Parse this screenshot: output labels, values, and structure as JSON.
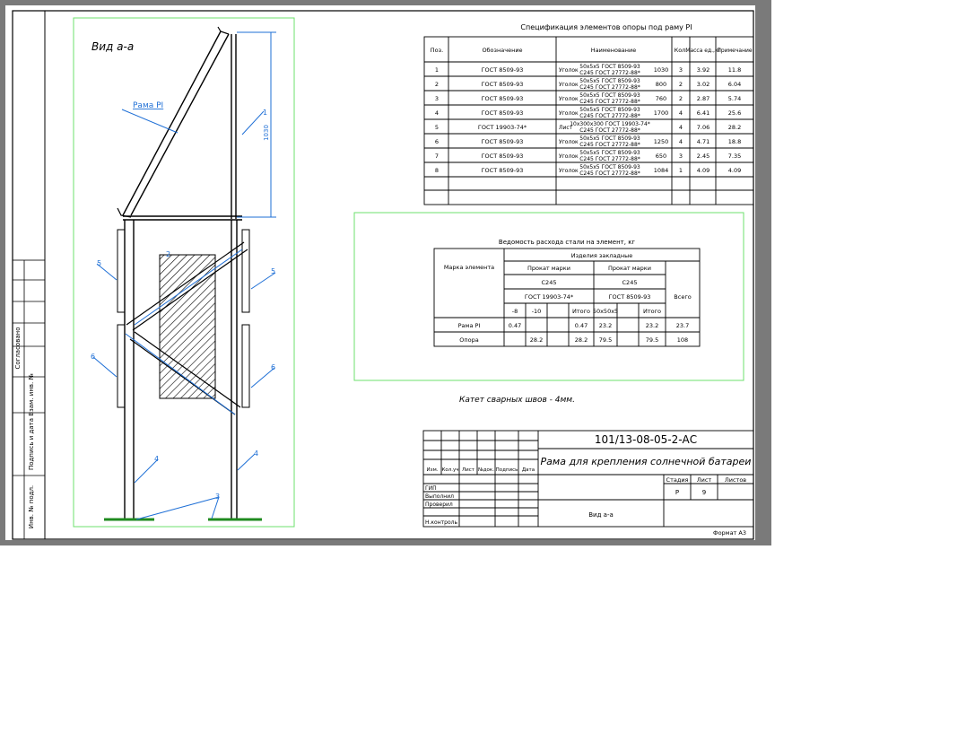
{
  "view_title": "Вид а-а",
  "frame_label": "Рама PI",
  "dimension_1": "1030",
  "markers": [
    "1",
    "2",
    "3",
    "4",
    "5",
    "6"
  ],
  "stamp_side": [
    "Согласовано",
    "Взам. инв. №",
    "Подпись и дата",
    "Инв. № подл."
  ],
  "spec": {
    "title": "Спецификация элементов опоры под раму PI",
    "headers": [
      "Поз.",
      "Обозначение",
      "Наименование",
      "Кол.",
      "Масса ед.,кг",
      "Примечание"
    ],
    "rows": [
      {
        "pos": "1",
        "designation": "ГОСТ 8509-93",
        "name_prefix": "Уголок",
        "name_top": "50х5х5 ГОСТ 8509-93",
        "name_bottom": "С245 ГОСТ 27772-88*",
        "length": "1030",
        "qty": "3",
        "mass": "3.92",
        "note": "11.8"
      },
      {
        "pos": "2",
        "designation": "ГОСТ 8509-93",
        "name_prefix": "Уголок",
        "name_top": "50х5х5 ГОСТ 8509-93",
        "name_bottom": "С245 ГОСТ 27772-88*",
        "length": "800",
        "qty": "2",
        "mass": "3.02",
        "note": "6.04"
      },
      {
        "pos": "3",
        "designation": "ГОСТ 8509-93",
        "name_prefix": "Уголок",
        "name_top": "50х5х5 ГОСТ 8509-93",
        "name_bottom": "С245 ГОСТ 27772-88*",
        "length": "760",
        "qty": "2",
        "mass": "2.87",
        "note": "5.74"
      },
      {
        "pos": "4",
        "designation": "ГОСТ 8509-93",
        "name_prefix": "Уголок",
        "name_top": "50х5х5 ГОСТ 8509-93",
        "name_bottom": "С245 ГОСТ 27772-88*",
        "length": "1700",
        "qty": "4",
        "mass": "6.41",
        "note": "25.6"
      },
      {
        "pos": "5",
        "designation": "ГОСТ 19903-74*",
        "name_prefix": "Лист",
        "name_top": "10х300х300 ГОСТ 19903-74*",
        "name_bottom": "С245 ГОСТ 27772-88*",
        "length": "",
        "qty": "4",
        "mass": "7.06",
        "note": "28.2"
      },
      {
        "pos": "6",
        "designation": "ГОСТ 8509-93",
        "name_prefix": "Уголок",
        "name_top": "50х5х5 ГОСТ 8509-93",
        "name_bottom": "С245 ГОСТ 27772-88*",
        "length": "1250",
        "qty": "4",
        "mass": "4.71",
        "note": "18.8"
      },
      {
        "pos": "7",
        "designation": "ГОСТ 8509-93",
        "name_prefix": "Уголок",
        "name_top": "50х5х5 ГОСТ 8509-93",
        "name_bottom": "С245 ГОСТ 27772-88*",
        "length": "650",
        "qty": "3",
        "mass": "2.45",
        "note": "7.35"
      },
      {
        "pos": "8",
        "designation": "ГОСТ 8509-93",
        "name_prefix": "Уголок",
        "name_top": "50х5х5 ГОСТ 8509-93",
        "name_bottom": "С245 ГОСТ 27772-88*",
        "length": "1084",
        "qty": "1",
        "mass": "4.09",
        "note": "4.09"
      }
    ]
  },
  "steel": {
    "title": "Ведомость расхода стали на элемент, кг",
    "col_mark": "Марка элемента",
    "col_group": "Изделия закладные",
    "col_prokat1": "Прокат марки",
    "col_prokat2": "Прокат марки",
    "grade1": "С245",
    "grade2": "С245",
    "gost1": "ГОСТ 19903-74*",
    "gost2": "ГОСТ 8509-93",
    "col_total": "Всего",
    "sub": [
      "-8",
      "-10",
      "Итого",
      "50х50х5",
      "Итого"
    ],
    "rows": [
      {
        "name": "Рама PI",
        "c1": "0.47",
        "c2": "",
        "c3": "0.47",
        "c4": "23.2",
        "c5": "23.2",
        "total": "23.7"
      },
      {
        "name": "Опора",
        "c1": "",
        "c2": "28.2",
        "c3": "28.2",
        "c4": "79.5",
        "c5": "79.5",
        "total": "108"
      }
    ]
  },
  "note": "Катет сварных швов - 4мм.",
  "title_block": {
    "code": "101/13-08-05-2-АС",
    "name": "Рама для крепления солнечной батареи",
    "headers": [
      "Изм.",
      "Кол.уч",
      "Лист",
      "№док.",
      "Подпись",
      "Дата"
    ],
    "roles": [
      "ГИП",
      "Выполнил",
      "Проверил",
      "",
      "Н.контроль"
    ],
    "stage_label": "Стадия",
    "sheet_label": "Лист",
    "sheets_label": "Листов",
    "stage": "Р",
    "sheet": "9",
    "sheet_title": "Вид а-а",
    "format": "Формат А3"
  }
}
